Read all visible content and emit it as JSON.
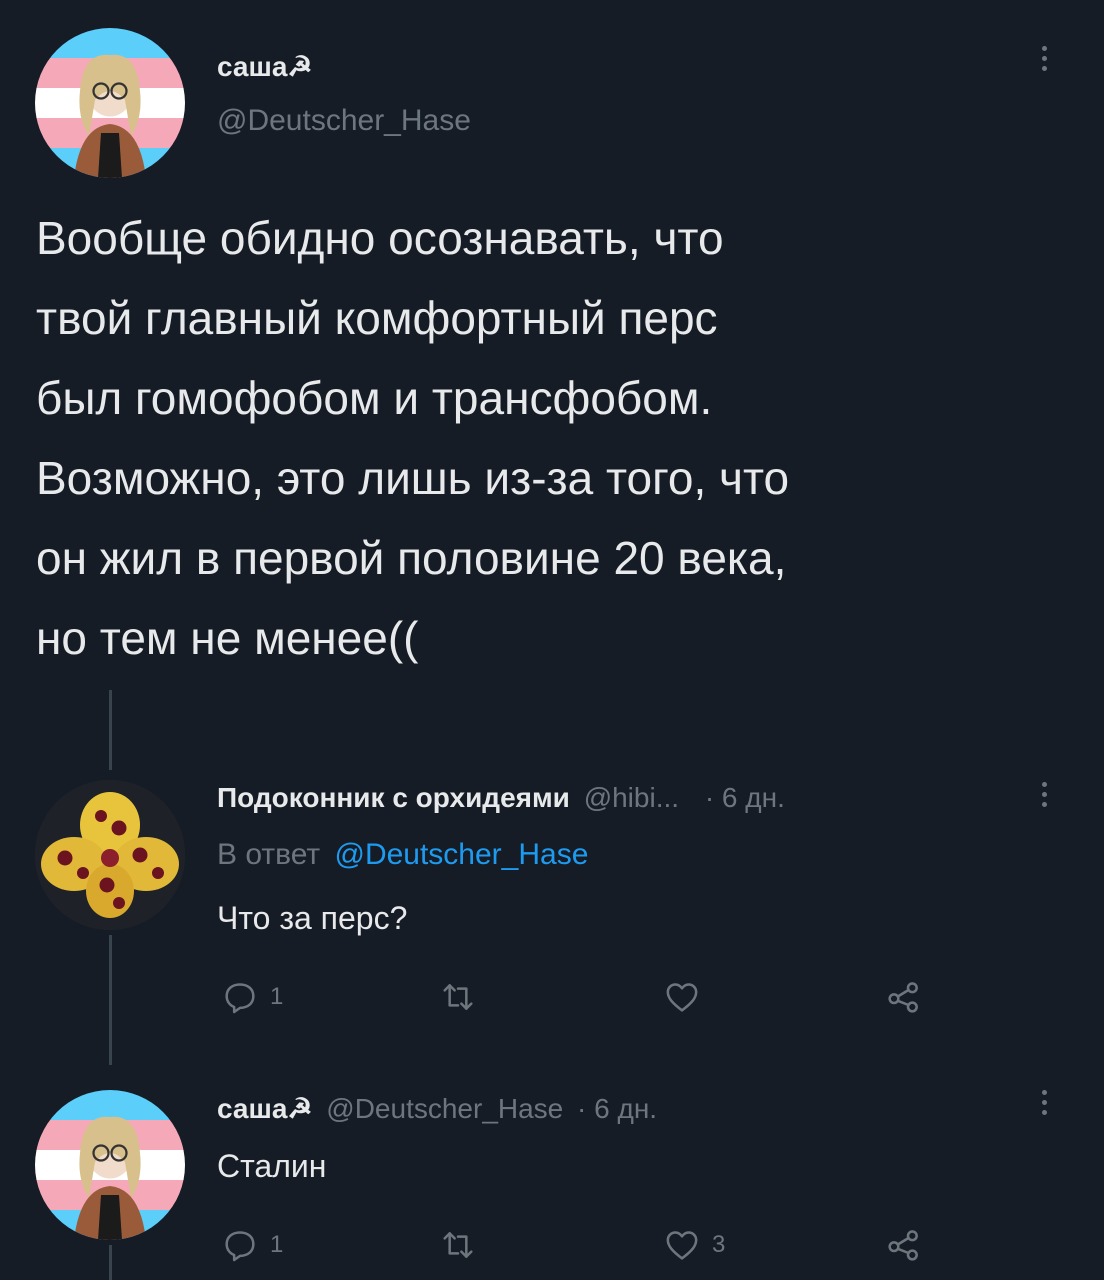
{
  "main_tweet": {
    "display_name": "саша☭",
    "handle": "@Deutscher_Hase",
    "text_lines": [
      "Вообще обидно осознавать, что",
      "твой главный комфортный перс",
      "был гомофобом и трансфобом.",
      "Возможно, это лишь из-за того, что",
      "он жил в первой половине 20 века,",
      "но тем не менее(("
    ]
  },
  "reply1": {
    "display_name": "Подоконник с орхидеями",
    "handle": "@hibi...",
    "time": "· 6 дн.",
    "reply_to_prefix": "В ответ",
    "reply_to_handle": "@Deutscher_Hase",
    "text": "Что за перс?",
    "replies_count": "1"
  },
  "reply2": {
    "display_name": "саша☭",
    "handle": "@Deutscher_Hase",
    "time": "· 6 дн.",
    "text": "Сталин",
    "replies_count": "1",
    "likes_count": "3"
  },
  "colors": {
    "background": "#161c26",
    "text": "#e7e9ea",
    "muted": "#6e767d",
    "link": "#1d9bf0"
  },
  "icons": [
    "more-icon",
    "reply-icon",
    "retweet-icon",
    "like-icon",
    "share-icon"
  ]
}
